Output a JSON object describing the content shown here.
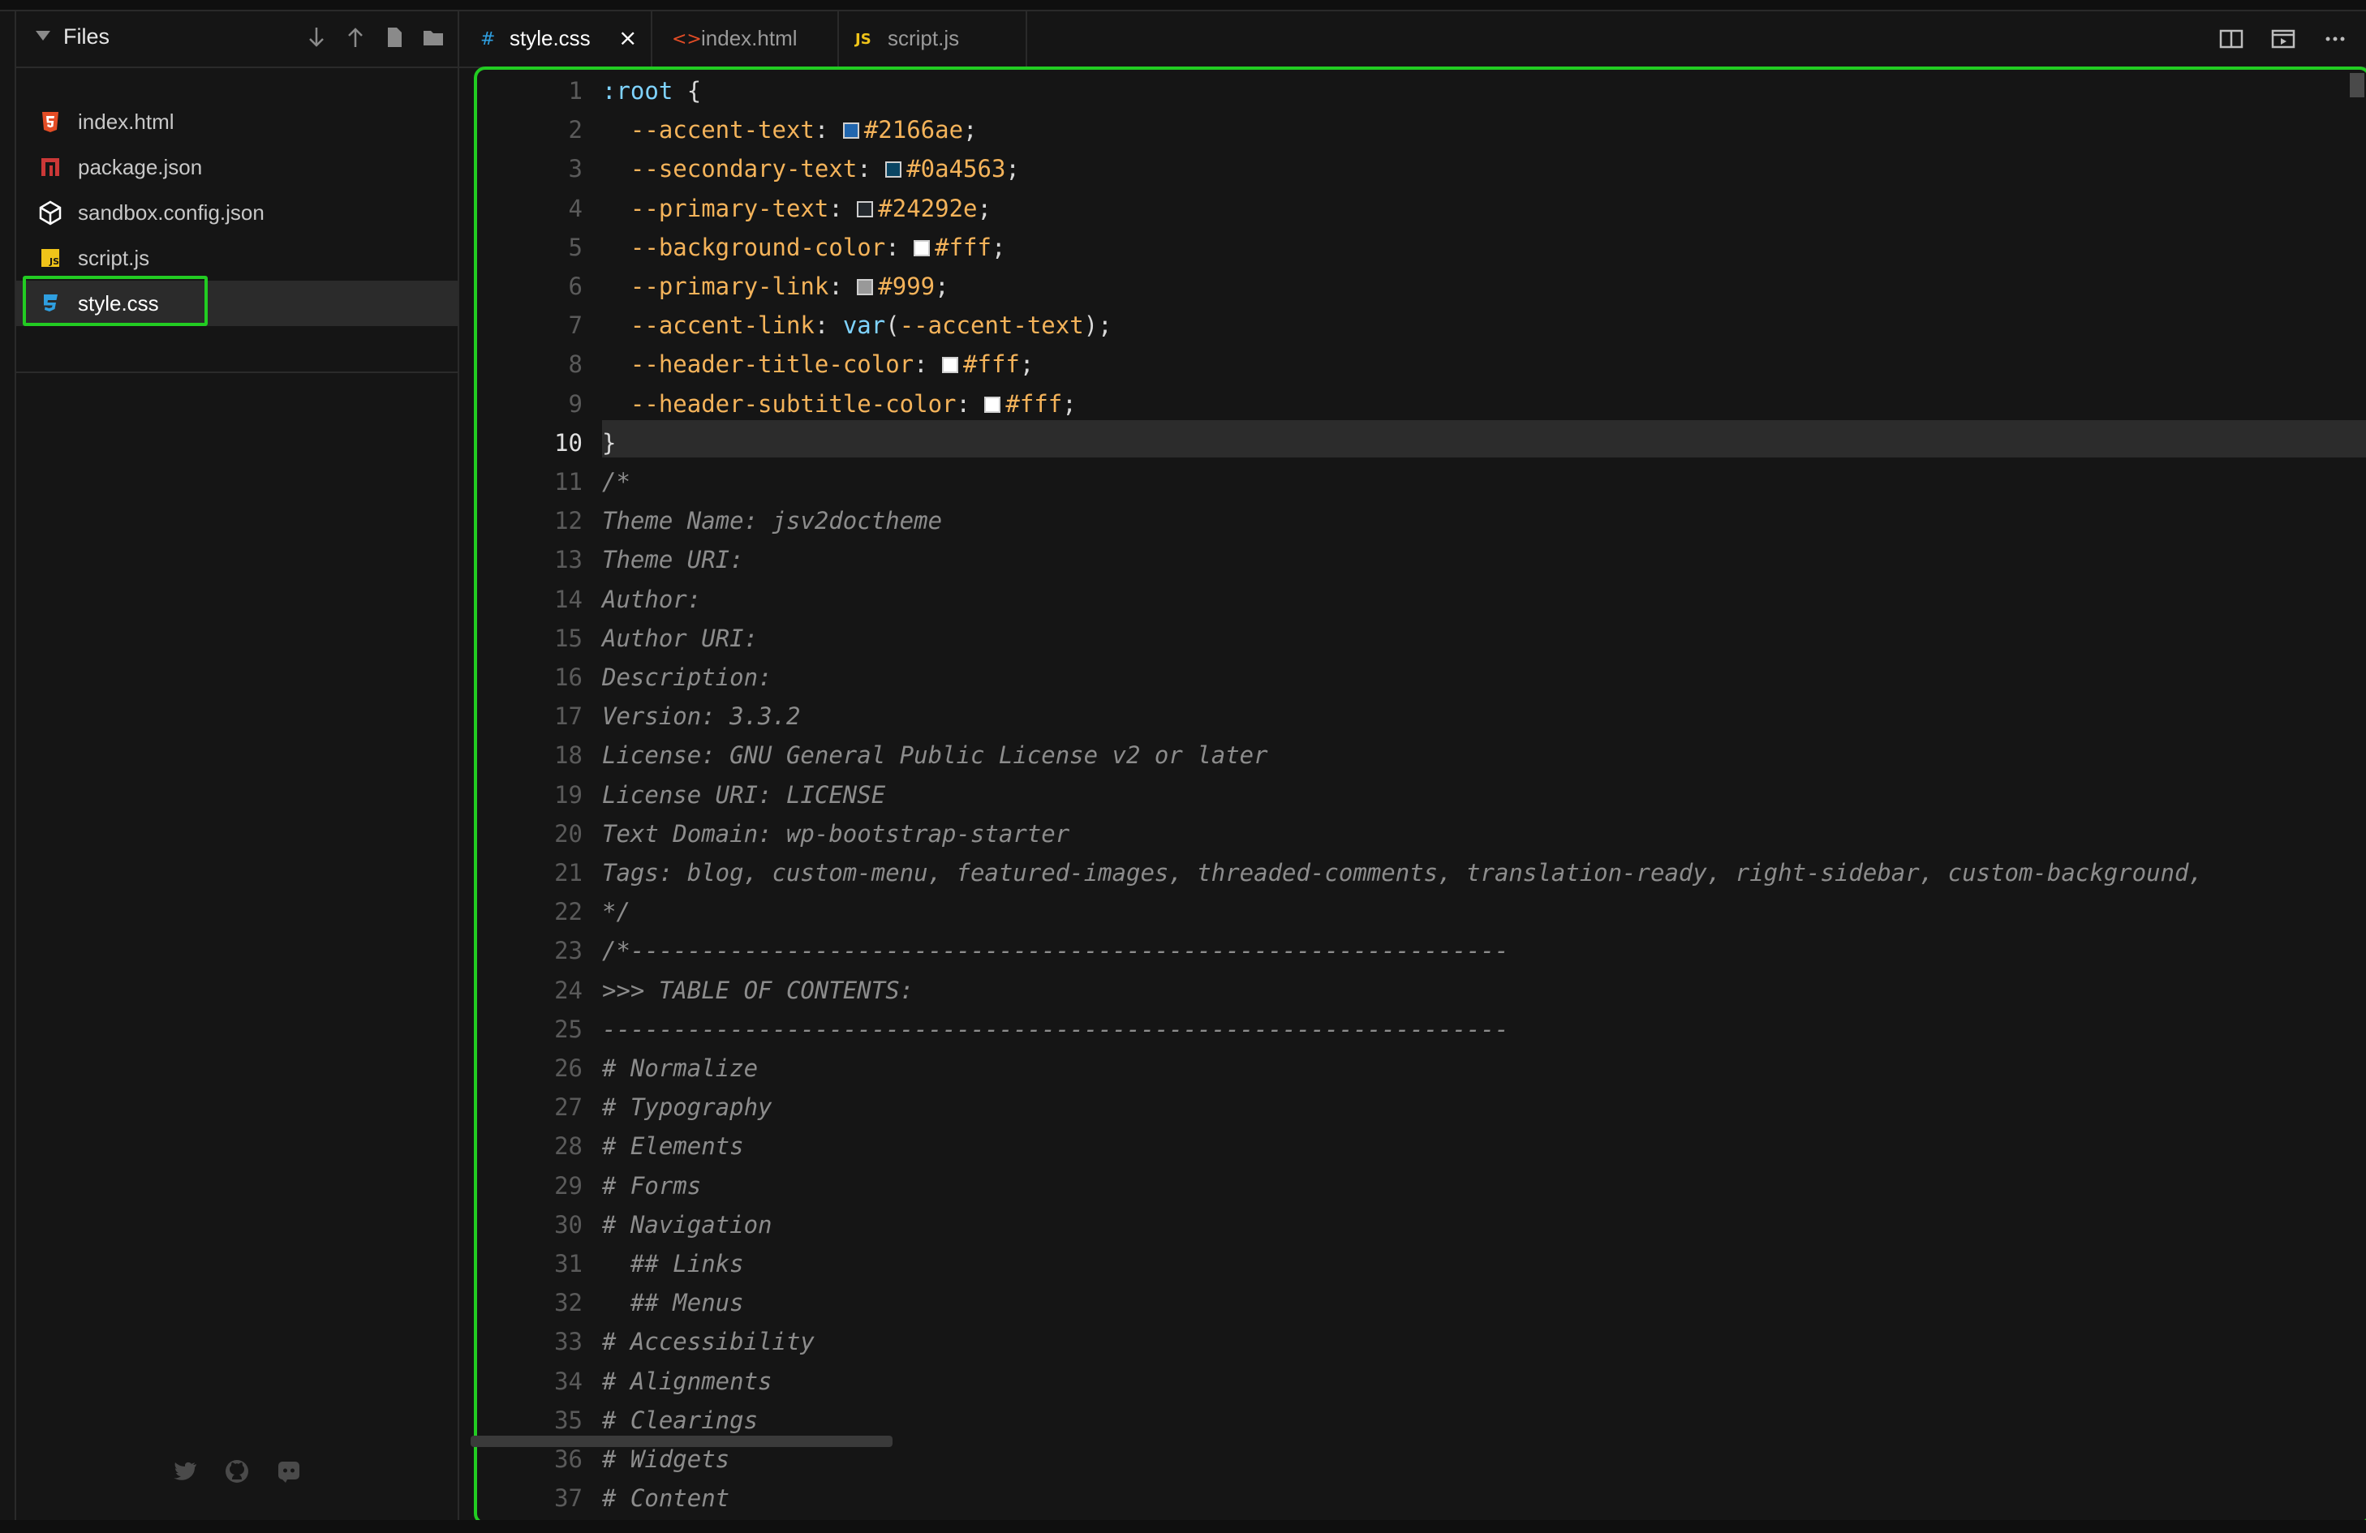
{
  "sidebar": {
    "title": "Files",
    "files": [
      {
        "name": "index.html",
        "icon": "html5-icon",
        "color": "#e44d26"
      },
      {
        "name": "package.json",
        "icon": "npm-icon",
        "color": "#cb3837"
      },
      {
        "name": "sandbox.config.json",
        "icon": "codesandbox-cube-icon",
        "color": "#ffffff"
      },
      {
        "name": "script.js",
        "icon": "js-icon",
        "color": "#f0c419"
      },
      {
        "name": "style.css",
        "icon": "css3-icon",
        "color": "#2f9fe0"
      }
    ],
    "active_file": "style.css"
  },
  "tabs": [
    {
      "label": "style.css",
      "icon_glyph": "#",
      "icon_color": "#2f9fe0",
      "active": true
    },
    {
      "label": "index.html",
      "icon_glyph": "<>",
      "icon_color": "#e44d26",
      "active": false
    },
    {
      "label": "script.js",
      "icon_glyph": "JS",
      "icon_color": "#f0c419",
      "active": false
    }
  ],
  "tab_close": "×",
  "editor": {
    "current_line": 10,
    "lines": [
      ":root {",
      "  --accent-text: #2166ae;",
      "  --secondary-text: #0a4563;",
      "  --primary-text: #24292e;",
      "  --background-color: #fff;",
      "  --primary-link: #999;",
      "  --accent-link: var(--accent-text);",
      "  --header-title-color: #fff;",
      "  --header-subtitle-color: #fff;",
      "}",
      "/*",
      "Theme Name: jsv2doctheme",
      "Theme URI:",
      "Author:",
      "Author URI:",
      "Description:",
      "Version: 3.3.2",
      "License: GNU General Public License v2 or later",
      "License URI: LICENSE",
      "Text Domain: wp-bootstrap-starter",
      "Tags: blog, custom-menu, featured-images, threaded-comments, translation-ready, right-sidebar, custom-background,",
      "*/",
      "/*--------------------------------------------------------------",
      ">>> TABLE OF CONTENTS:",
      "----------------------------------------------------------------",
      "# Normalize",
      "# Typography",
      "# Elements",
      "# Forms",
      "# Navigation",
      "  ## Links",
      "  ## Menus",
      "# Accessibility",
      "# Alignments",
      "# Clearings",
      "# Widgets",
      "# Content"
    ]
  },
  "colors": {
    "accent_green": "#22cc22",
    "background": "#151515",
    "selector": "#7fd3ff",
    "property": "#f4b35a",
    "comment": "#8c8c8c"
  }
}
